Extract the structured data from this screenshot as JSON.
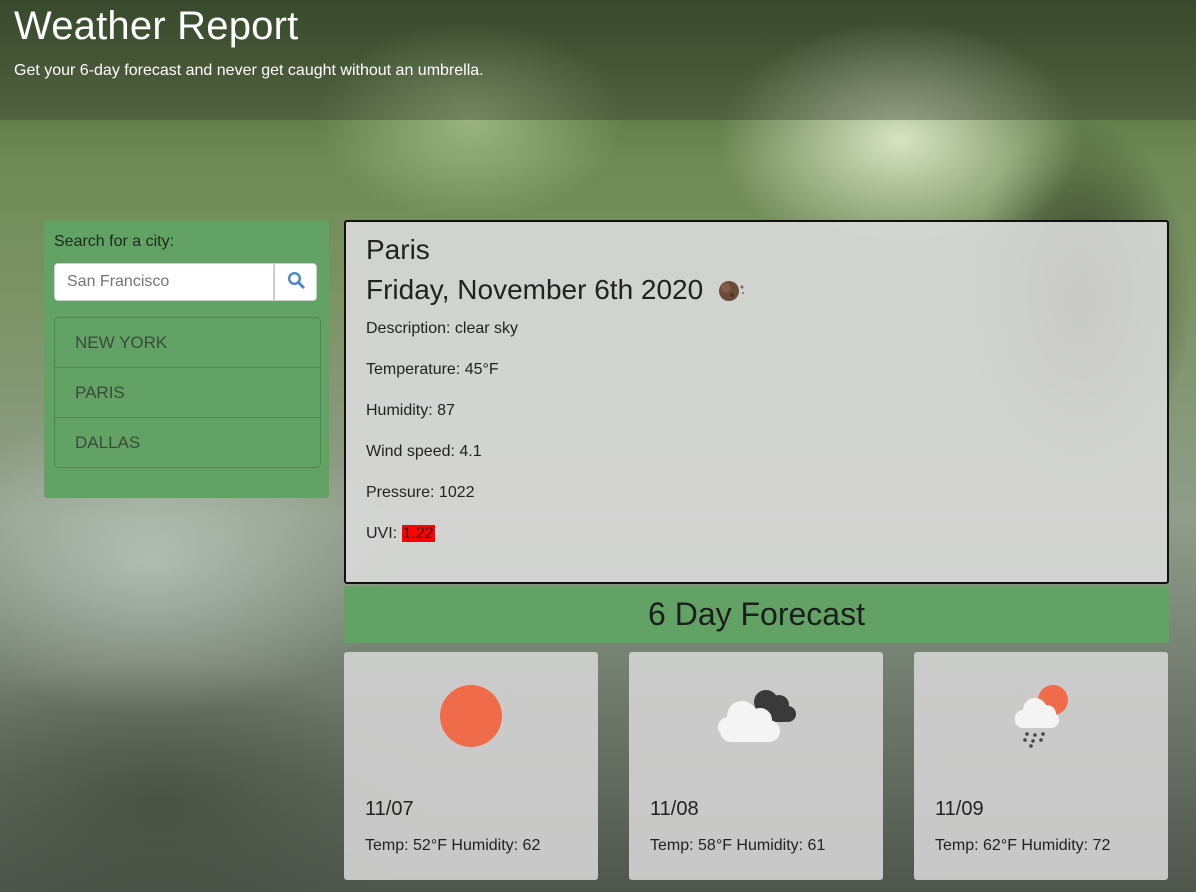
{
  "header": {
    "title": "Weather Report",
    "subtitle": "Get your 6-day forecast and never get caught without an umbrella."
  },
  "search": {
    "label": "Search for a city:",
    "placeholder": "San Francisco",
    "value": "",
    "button_icon": "search-icon",
    "history": [
      "NEW YORK",
      "PARIS",
      "DALLAS"
    ]
  },
  "current": {
    "city": "Paris",
    "date": "Friday, November 6th 2020",
    "icon": "moon-icon",
    "description": "Description: clear sky",
    "temperature": "Temperature: 45°F",
    "humidity": "Humidity: 87",
    "wind": "Wind speed: 4.1",
    "pressure": "Pressure: 1022",
    "uvi_label": "UVI: ",
    "uvi_value": "1.22"
  },
  "forecast": {
    "title": "6 Day Forecast",
    "days": [
      {
        "date": "11/07",
        "icon": "sun-icon",
        "stats": "Temp: 52°F Humidity: 62"
      },
      {
        "date": "11/08",
        "icon": "cloudy-icon",
        "stats": "Temp: 58°F Humidity: 61"
      },
      {
        "date": "11/09",
        "icon": "rain-sun-icon",
        "stats": "Temp: 62°F Humidity: 72"
      }
    ]
  },
  "colors": {
    "panel_green": "#62a365",
    "uvi_red": "#ff0000",
    "sun_orange": "#ef6b4a"
  }
}
